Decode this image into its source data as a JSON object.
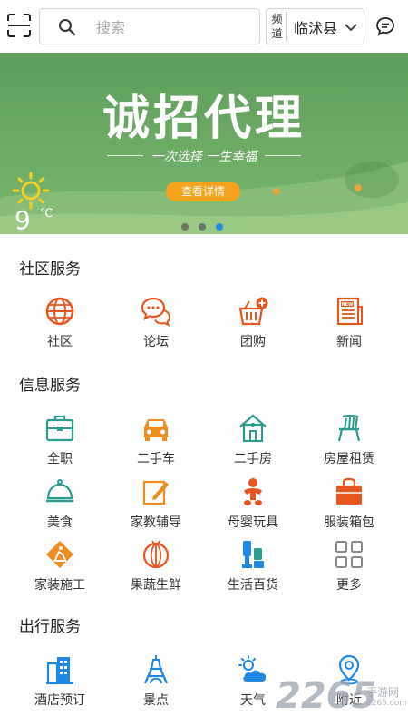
{
  "header": {
    "search_placeholder": "搜索",
    "channel_tag": "频道",
    "channel_value": "临沭县"
  },
  "banner": {
    "title": "诚招代理",
    "slogan": "一次选择 一生幸福",
    "cta": "查看详情",
    "temperature": "9",
    "temperature_unit": "℃",
    "slides": 3,
    "active_slide": 3
  },
  "sections": {
    "community": {
      "title": "社区服务",
      "items": [
        {
          "label": "社区",
          "icon": "globe-icon",
          "color": "#e8561f"
        },
        {
          "label": "论坛",
          "icon": "chat-bubbles-icon",
          "color": "#e8561f"
        },
        {
          "label": "团购",
          "icon": "shopping-basket-icon",
          "color": "#e8561f"
        },
        {
          "label": "新闻",
          "icon": "newspaper-icon",
          "color": "#e8561f"
        }
      ]
    },
    "info": {
      "title": "信息服务",
      "items": [
        {
          "label": "全职",
          "icon": "briefcase-icon",
          "color": "#2a9d8f"
        },
        {
          "label": "二手车",
          "icon": "car-icon",
          "color": "#f08c1f"
        },
        {
          "label": "二手房",
          "icon": "house-icon",
          "color": "#2a9d8f"
        },
        {
          "label": "房屋租赁",
          "icon": "chair-icon",
          "color": "#2a9d8f"
        },
        {
          "label": "美食",
          "icon": "food-cloche-icon",
          "color": "#2a9d8f"
        },
        {
          "label": "家教辅导",
          "icon": "pencil-edit-icon",
          "color": "#f08c1f"
        },
        {
          "label": "母婴玩具",
          "icon": "baby-icon",
          "color": "#e8561f"
        },
        {
          "label": "服装箱包",
          "icon": "bag-icon",
          "color": "#e8561f"
        },
        {
          "label": "家装施工",
          "icon": "construction-sign-icon",
          "color": "#f08c1f"
        },
        {
          "label": "果蔬生鲜",
          "icon": "melon-icon",
          "color": "#e8561f"
        },
        {
          "label": "生活百货",
          "icon": "household-goods-icon",
          "color": "#1e88e5"
        },
        {
          "label": "更多",
          "icon": "grid-more-icon",
          "color": "#888888"
        }
      ]
    },
    "travel": {
      "title": "出行服务",
      "items": [
        {
          "label": "酒店预订",
          "icon": "hotel-building-icon",
          "color": "#1e88e5"
        },
        {
          "label": "景点",
          "icon": "tower-icon",
          "color": "#1e88e5"
        },
        {
          "label": "天气",
          "icon": "weather-cloud-icon",
          "color": "#1e88e5"
        },
        {
          "label": "附近",
          "icon": "location-pin-icon",
          "color": "#1e88e5"
        }
      ]
    }
  },
  "watermark": {
    "number": "2265",
    "text": "手游网",
    "sub": "2265.com"
  }
}
